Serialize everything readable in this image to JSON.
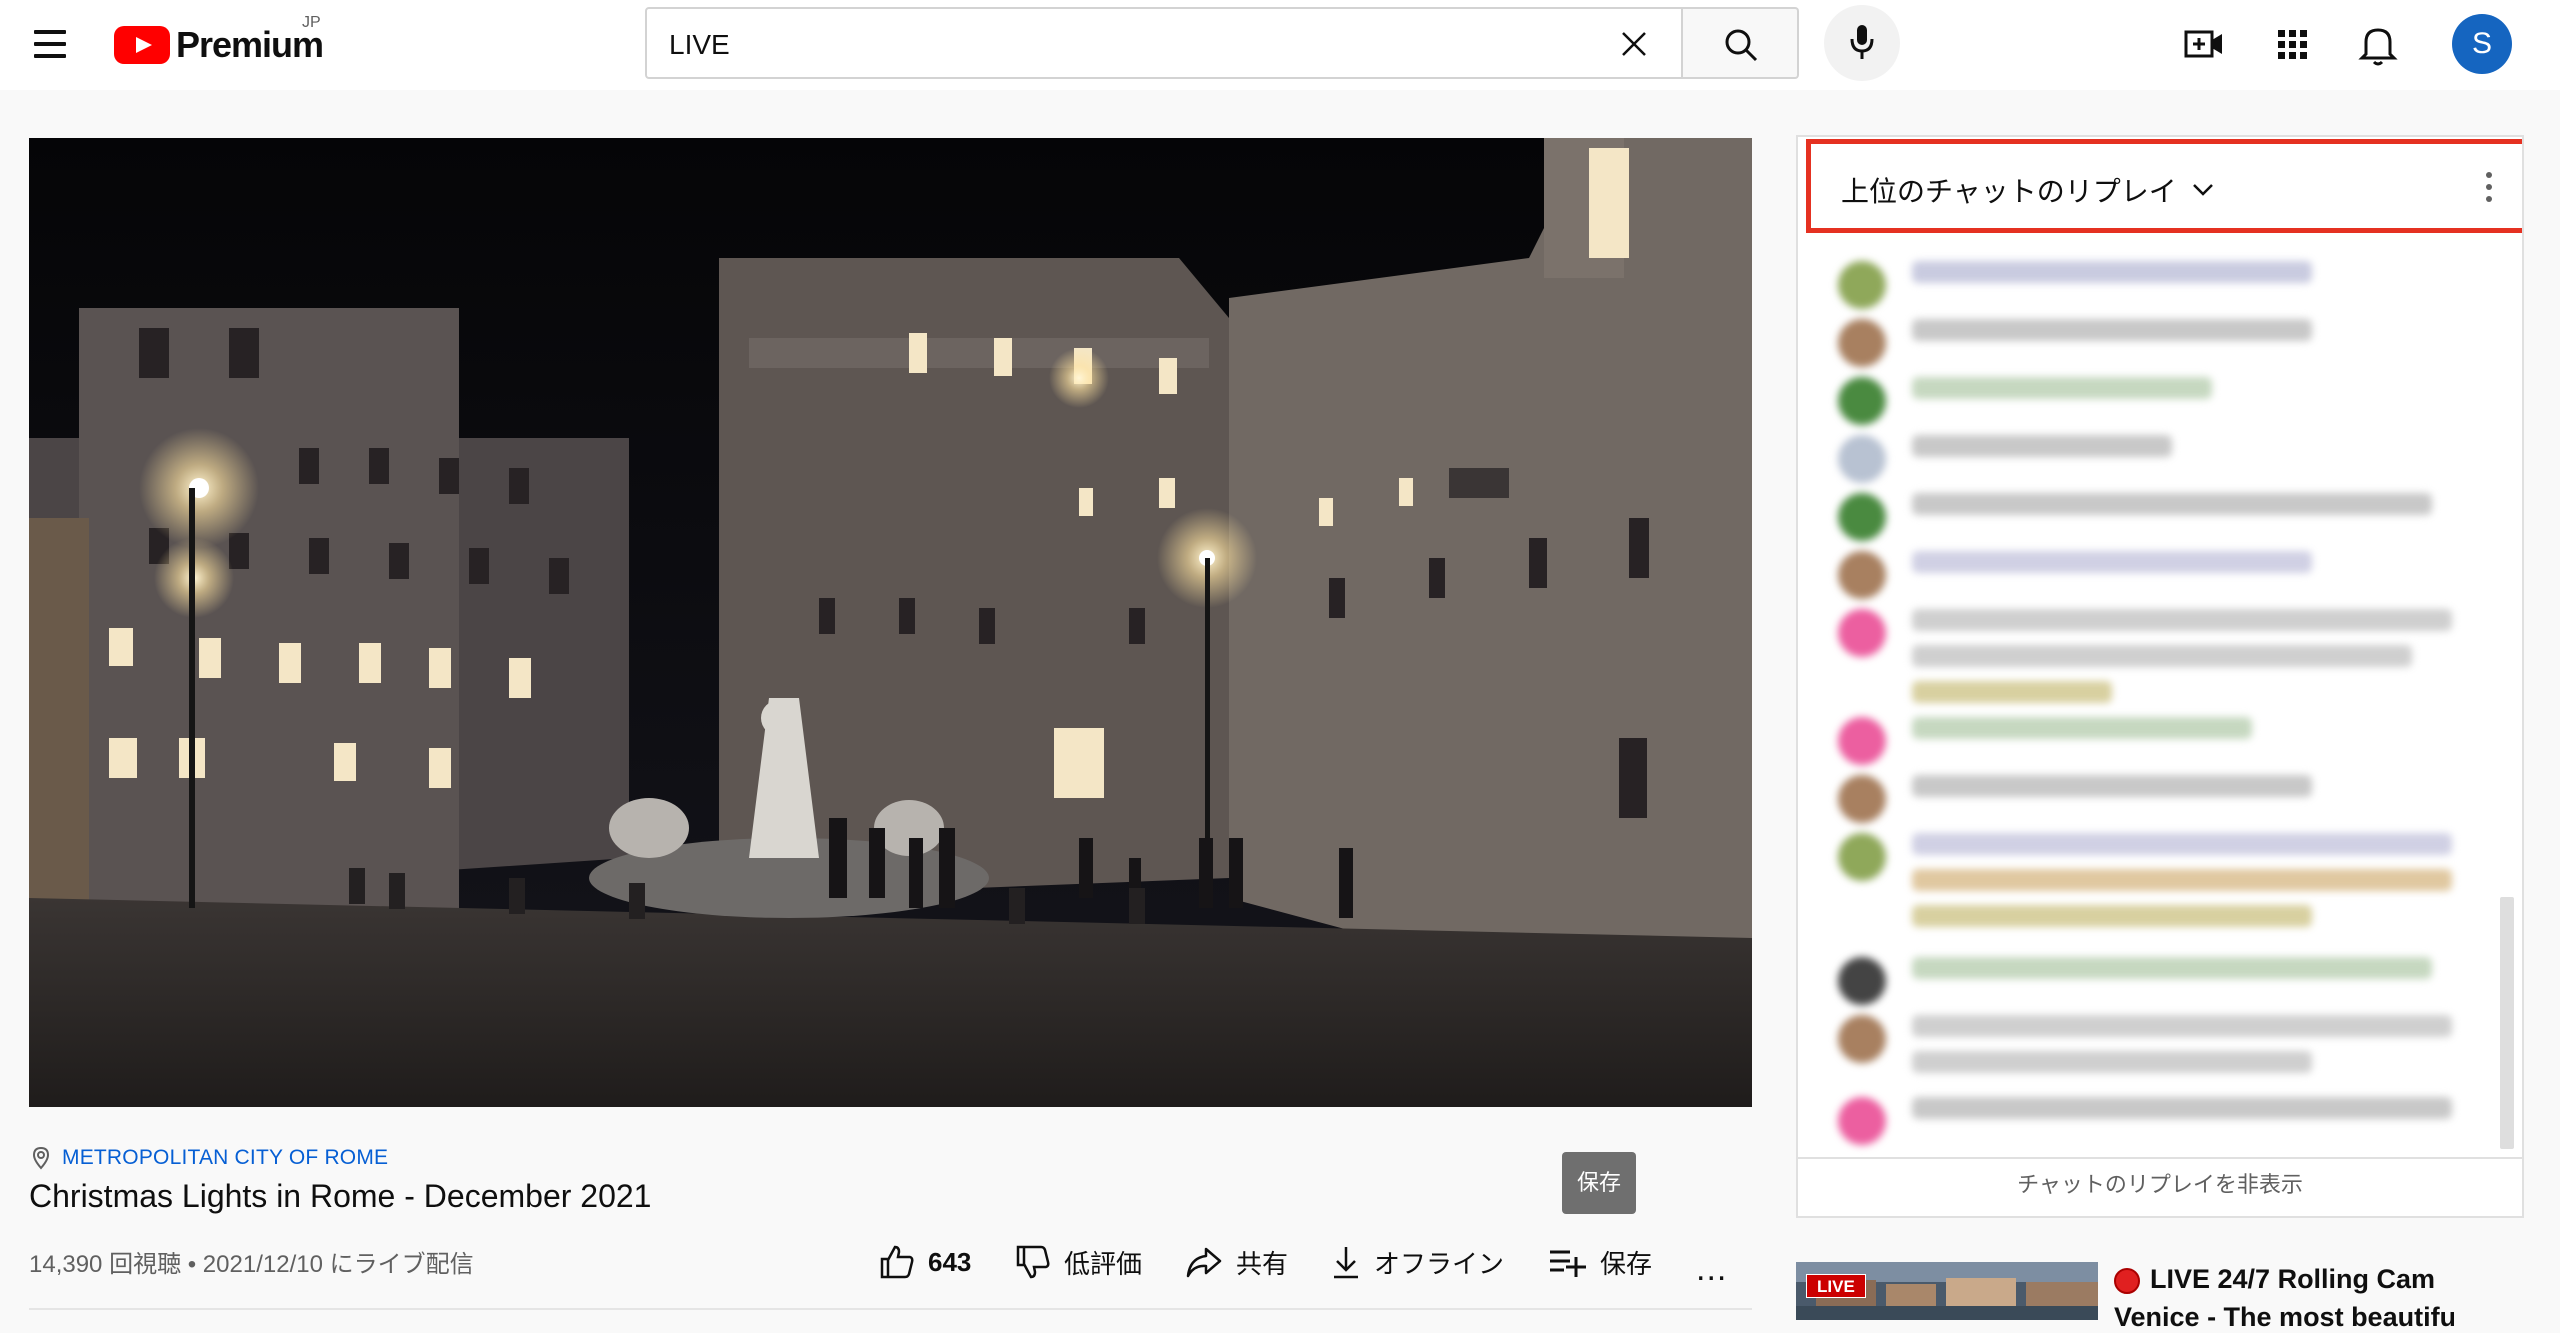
{
  "header": {
    "logo_text": "Premium",
    "country_code": "JP",
    "search_value": "LIVE",
    "avatar_letter": "S"
  },
  "video": {
    "location": "METROPOLITAN CITY OF ROME",
    "title": "Christmas Lights in Rome - December 2021",
    "meta": "14,390 回視聴 • 2021/12/10 にライブ配信",
    "tooltip": "保存"
  },
  "actions": {
    "like_count": "643",
    "dislike_label": "低評価",
    "share_label": "共有",
    "download_label": "オフライン",
    "save_label": "保存",
    "more_label": "..."
  },
  "chat": {
    "title": "上位のチャットのリプレイ",
    "hide_label": "チャットのリプレイを非表示"
  },
  "recommendation": {
    "live_badge": "LIVE",
    "title_line1": "LIVE 24/7 Rolling Cam",
    "title_line2": "Venice - The most beautiful Li"
  },
  "colors": {
    "accent_red": "#ff0000",
    "highlight_border": "#e53121",
    "link_blue": "#065fd4",
    "avatar_blue": "#1565c0"
  }
}
